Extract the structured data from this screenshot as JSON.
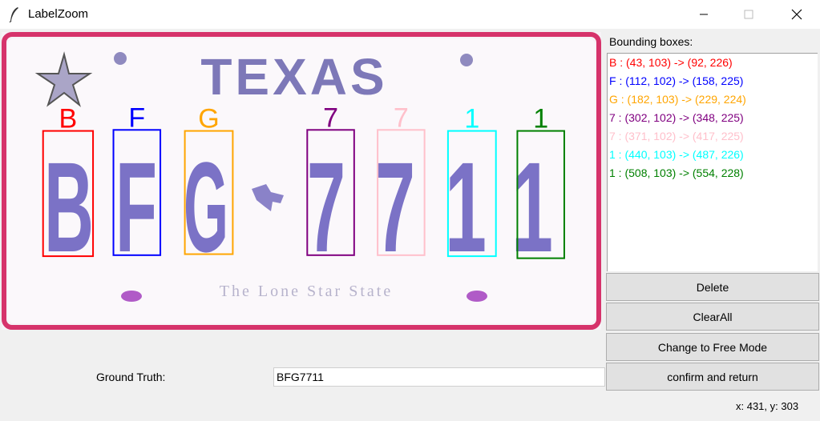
{
  "window": {
    "title": "LabelZoom",
    "icon": "feather-icon",
    "controls": [
      "minimize-icon",
      "maximize-icon",
      "close-icon"
    ]
  },
  "plate": {
    "state_text": "TEXAS",
    "plate_number": "BFG7711",
    "motto": "The Lone Star State",
    "frame_color": "#d6336b"
  },
  "boxes": [
    {
      "char": "B",
      "color": "#ff0000",
      "text": "B : (43, 103) -> (92, 226)"
    },
    {
      "char": "F",
      "color": "#0000ff",
      "text": "F : (112, 102) -> (158, 225)"
    },
    {
      "char": "G",
      "color": "#ffa500",
      "text": "G : (182, 103) -> (229, 224)"
    },
    {
      "char": "7",
      "color": "#800080",
      "text": "7 : (302, 102) -> (348, 225)"
    },
    {
      "char": "7",
      "color": "#ffc0cb",
      "text": "7 : (371, 102) -> (417, 225)"
    },
    {
      "char": "1",
      "color": "#00ffff",
      "text": "1 : (440, 103) -> (487, 226)"
    },
    {
      "char": "1",
      "color": "#008000",
      "text": "1 : (508, 103) -> (554, 228)"
    }
  ],
  "panel": {
    "title": "Bounding boxes:"
  },
  "buttons": {
    "delete": "Delete",
    "clear_all": "ClearAll",
    "free_mode": "Change to Free Mode",
    "confirm": "confirm and return"
  },
  "ground_truth": {
    "label": "Ground Truth:",
    "value": "BFG7711"
  },
  "status": {
    "coords": "x: 431, y: 303"
  }
}
